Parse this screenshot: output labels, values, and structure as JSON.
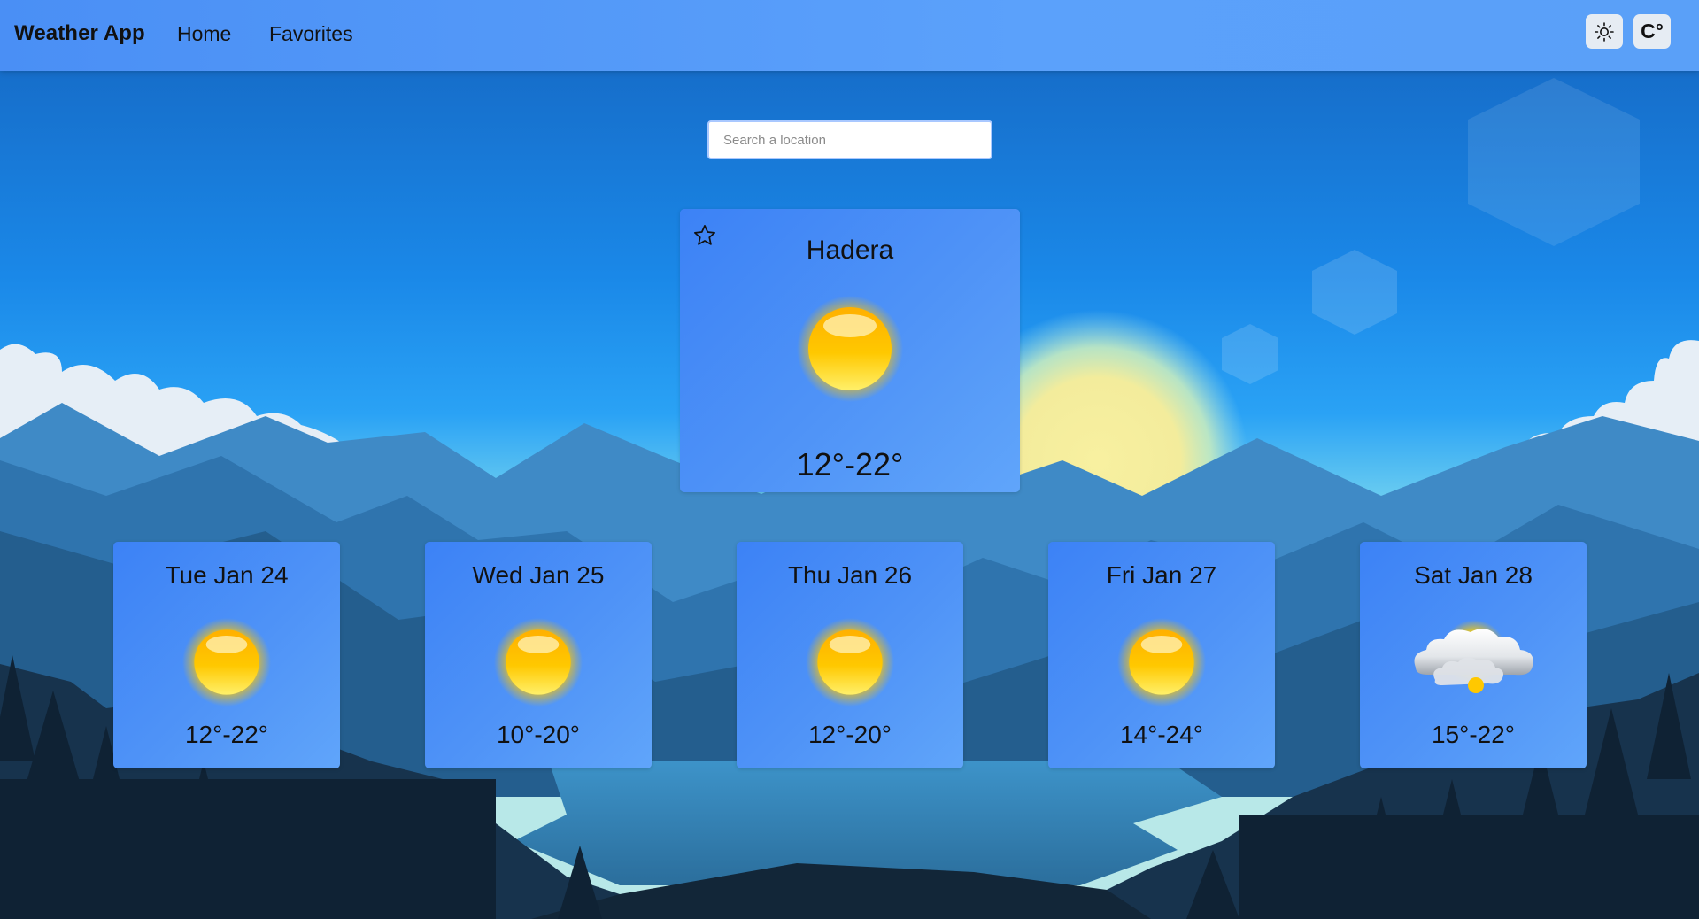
{
  "navbar": {
    "brand": "Weather App",
    "links": {
      "home": "Home",
      "favorites": "Favorites"
    },
    "unit_toggle": "C°",
    "theme_icon": "sun-icon"
  },
  "search": {
    "placeholder": "Search a location",
    "value": ""
  },
  "current": {
    "city": "Hadera",
    "icon": "sun-icon",
    "temp_range": "12°-22°",
    "favorite_icon": "star-outline-icon"
  },
  "forecast": [
    {
      "day": "Tue Jan 24",
      "icon": "sun-icon",
      "temp_range": "12°-22°"
    },
    {
      "day": "Wed Jan 25",
      "icon": "sun-icon",
      "temp_range": "10°-20°"
    },
    {
      "day": "Thu Jan 26",
      "icon": "sun-icon",
      "temp_range": "12°-20°"
    },
    {
      "day": "Fri Jan 27",
      "icon": "sun-icon",
      "temp_range": "14°-24°"
    },
    {
      "day": "Sat Jan 28",
      "icon": "partly-cloudy-icon",
      "temp_range": "15°-22°"
    }
  ],
  "colors": {
    "navbar": "#5299f8",
    "card": "#4a8ff7",
    "sky_top": "#1565c0",
    "sky_mid": "#1e96f0"
  }
}
